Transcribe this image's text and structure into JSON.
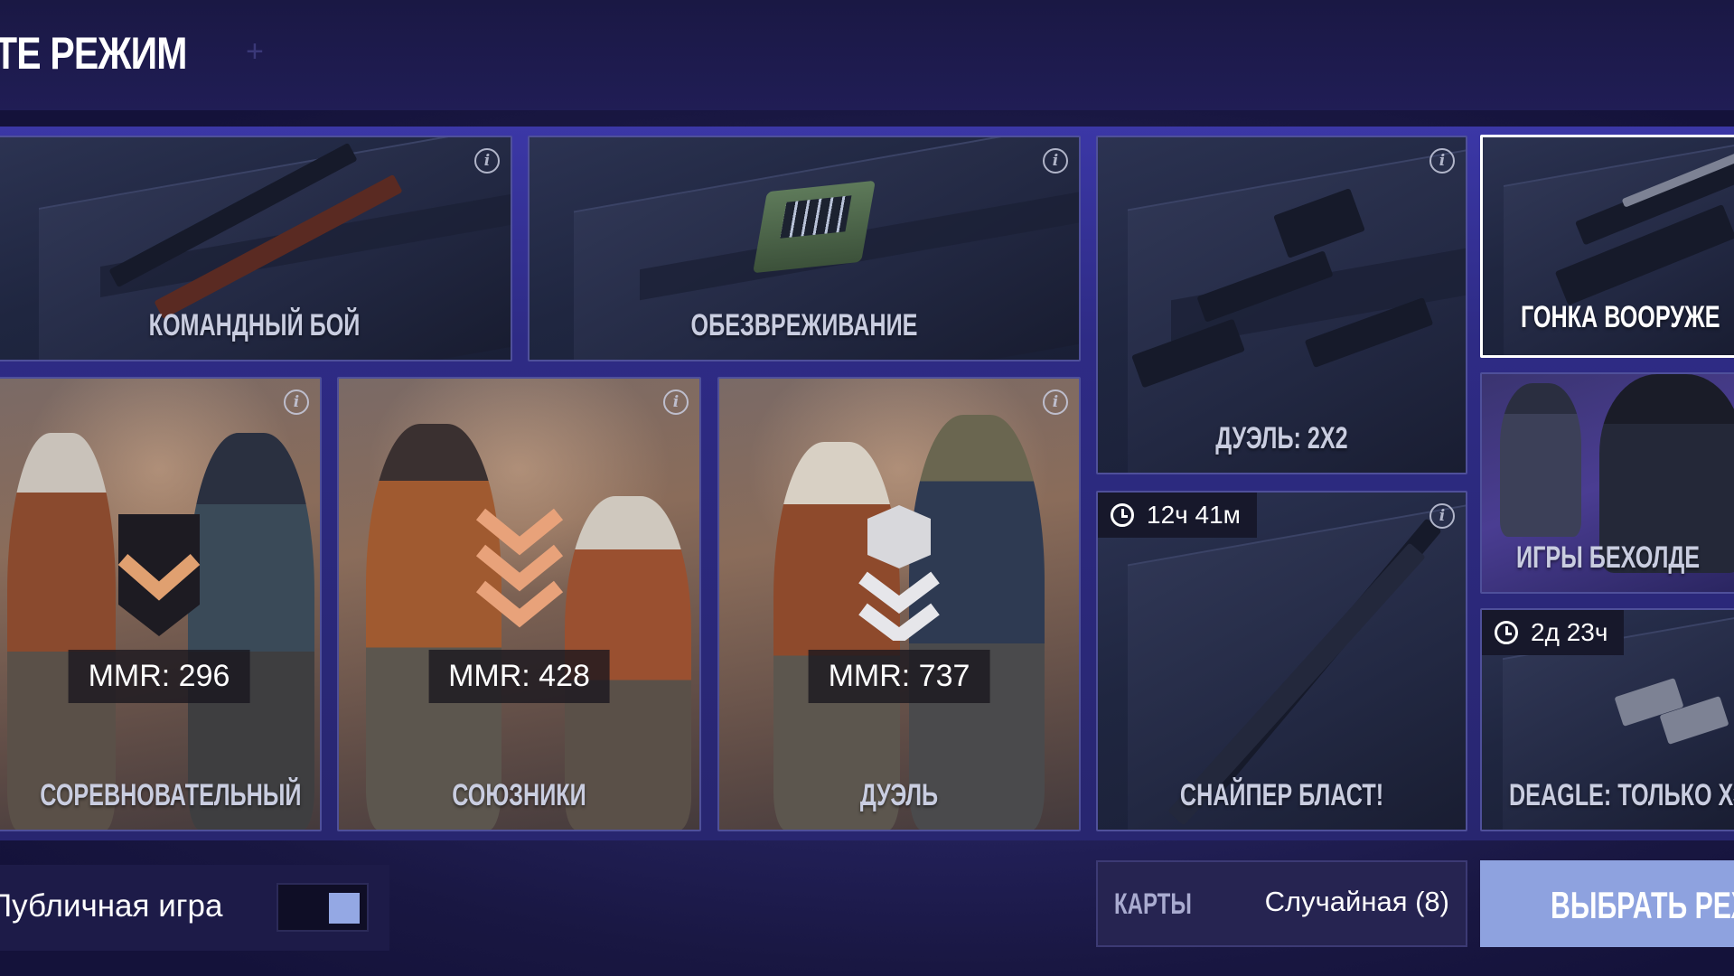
{
  "header": {
    "title": "ТЕ РЕЖИМ"
  },
  "cards": {
    "team_deathmatch": {
      "label": "КОМАНДНЫЙ БОЙ"
    },
    "defuse": {
      "label": "ОБЕЗВРЕЖИВАНИЕ"
    },
    "duel_2x2": {
      "label": "ДУЭЛЬ: 2X2"
    },
    "arms_race": {
      "label": "ГОНКА ВООРУЖЕ"
    },
    "competitive": {
      "label": "СОРЕВНОВАТЕЛЬНЫЙ",
      "mmr": "MMR: 296"
    },
    "allies": {
      "label": "СОЮЗНИКИ",
      "mmr": "MMR: 428"
    },
    "duel": {
      "label": "ДУЭЛЬ",
      "mmr": "MMR: 737"
    },
    "sniper_blast": {
      "label": "СНАЙПЕР БЛАСТ!",
      "timer": "12ч 41м"
    },
    "holder_games": {
      "label": "ИГРЫ БЕХОЛДЕ"
    },
    "deagle_only": {
      "label": "DEAGLE: ТОЛЬКО ХЭ",
      "timer": "2д 23ч"
    }
  },
  "footer": {
    "public_label": "Публичная игра",
    "public_toggle_on": true,
    "maps_label": "КАРТЫ",
    "maps_value": "Случайная (8)",
    "choose_button": "ВЫБРАТЬ РЕЖ"
  },
  "colors": {
    "background": "#1f1d52",
    "panel": "#2e2b85",
    "button": "#8ea2df",
    "toggle_knob": "#94a8e4",
    "selected_border": "#ffffff"
  },
  "icons": {
    "info": "info-icon",
    "timer": "clock-icon"
  }
}
